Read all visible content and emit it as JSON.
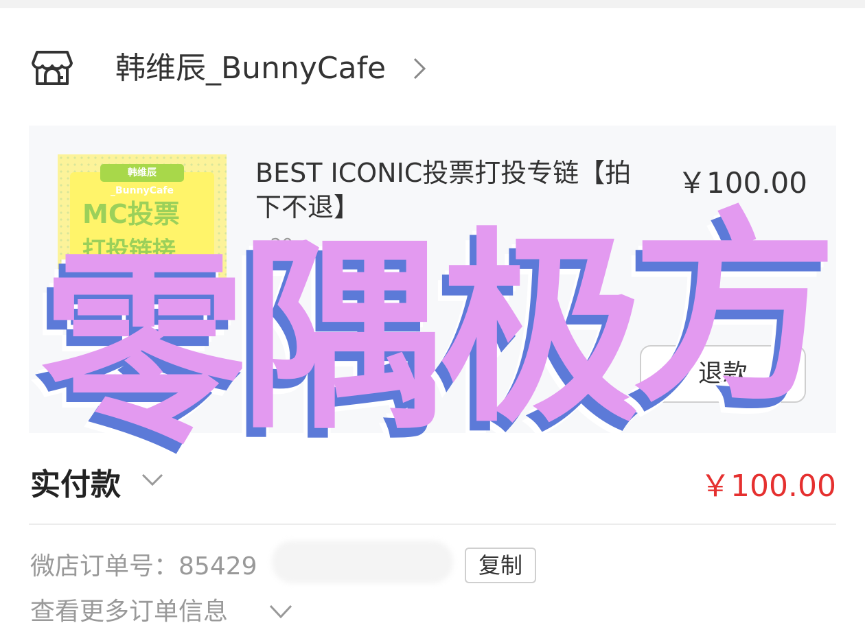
{
  "shop": {
    "name": "韩维辰_BunnyCafe",
    "icon": "shop-icon"
  },
  "item": {
    "title": "BEST ICONIC投票打投专链【拍下不退】",
    "price": "￥100.00",
    "qty": "×20",
    "thumbnail": {
      "tag": "韩维辰_BunnyCafe",
      "line1": "MC投票",
      "line2": "打投链接"
    },
    "refund_label": "退款"
  },
  "payment": {
    "label": "实付款",
    "amount": "￥100.00",
    "amount_color": "#e5302f"
  },
  "order": {
    "number_label": "微店订单号：",
    "number_visible": "85429",
    "copy_label": "复制",
    "more_label": "查看更多订单信息"
  },
  "watermark": {
    "text": [
      "零",
      "隅",
      "极",
      "方"
    ],
    "fill_color": "#e39af0",
    "shadow_color": "#5c7ad8"
  }
}
